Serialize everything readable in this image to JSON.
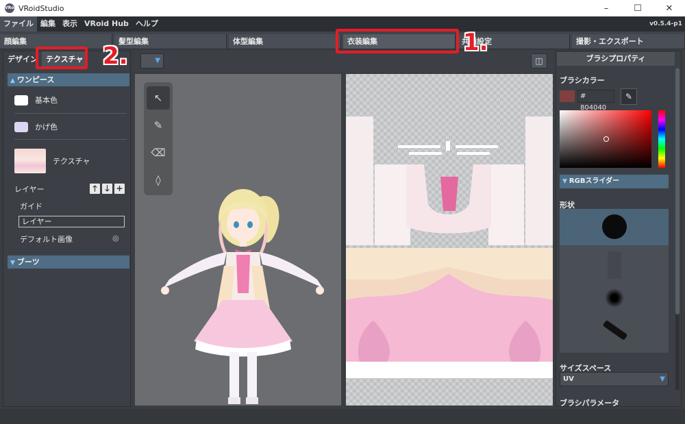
{
  "window": {
    "title": "VRoidStudio",
    "app_icon": "VRoid",
    "minimize_icon": "–",
    "maximize_icon": "☐",
    "close_icon": "✕"
  },
  "menu": {
    "items": [
      "ファイル",
      "編集",
      "表示",
      "VRoid Hub",
      "ヘルプ"
    ],
    "version": "v0.5.4-p1"
  },
  "mode_tabs": {
    "items": [
      "顔編集",
      "髪型編集",
      "体型編集",
      "衣装編集",
      "共通設定",
      "撮影・エクスポート"
    ],
    "active": "衣装編集"
  },
  "left_panel": {
    "tabs": [
      "デザイン",
      "テクスチャ"
    ],
    "active_tab": "テクスチャ",
    "section_onepiece": "ワンピース",
    "base_color_label": "基本色",
    "base_color": "#ffffff",
    "shade_color_label": "かげ色",
    "shade_color": "#dcd6f4",
    "texture_label": "テクスチャ",
    "layer_label": "レイヤー",
    "layer_up_icon": "🡑",
    "layer_down_icon": "🡓",
    "layer_add_icon": "+",
    "guide_label": "ガイド",
    "layer_item": "レイヤー",
    "default_image_label": "デフォルト画像",
    "eye_off_icon": "◎",
    "section_boots": "ブーツ",
    "section_icon": "▲",
    "section_boots_icon": "▼"
  },
  "toolbar": {
    "dropdown_icon": "▼",
    "mirror_icon": "◫",
    "tools": [
      {
        "name": "select-tool",
        "glyph": "↖",
        "active": true
      },
      {
        "name": "pen-tool",
        "glyph": "✎",
        "active": false
      },
      {
        "name": "eraser-tool",
        "glyph": "⌫",
        "active": false
      },
      {
        "name": "fill-tool",
        "glyph": "◊",
        "active": false
      }
    ]
  },
  "brush_panel": {
    "header": "ブラシプロパティ",
    "brush_color_label": "ブラシカラー",
    "hex_value": "# 804040",
    "brush_color": "#804040",
    "dropper_icon": "✎",
    "rgb_slider_label": "RGBスライダー",
    "rgb_icon": "▼",
    "shape_label": "形状",
    "size_space_label": "サイズスペース",
    "size_space_value": "UV",
    "size_space_icon": "▼",
    "brush_params_label": "ブラシパラメータ"
  },
  "annotations": {
    "num1": "1.",
    "num2": "2."
  }
}
